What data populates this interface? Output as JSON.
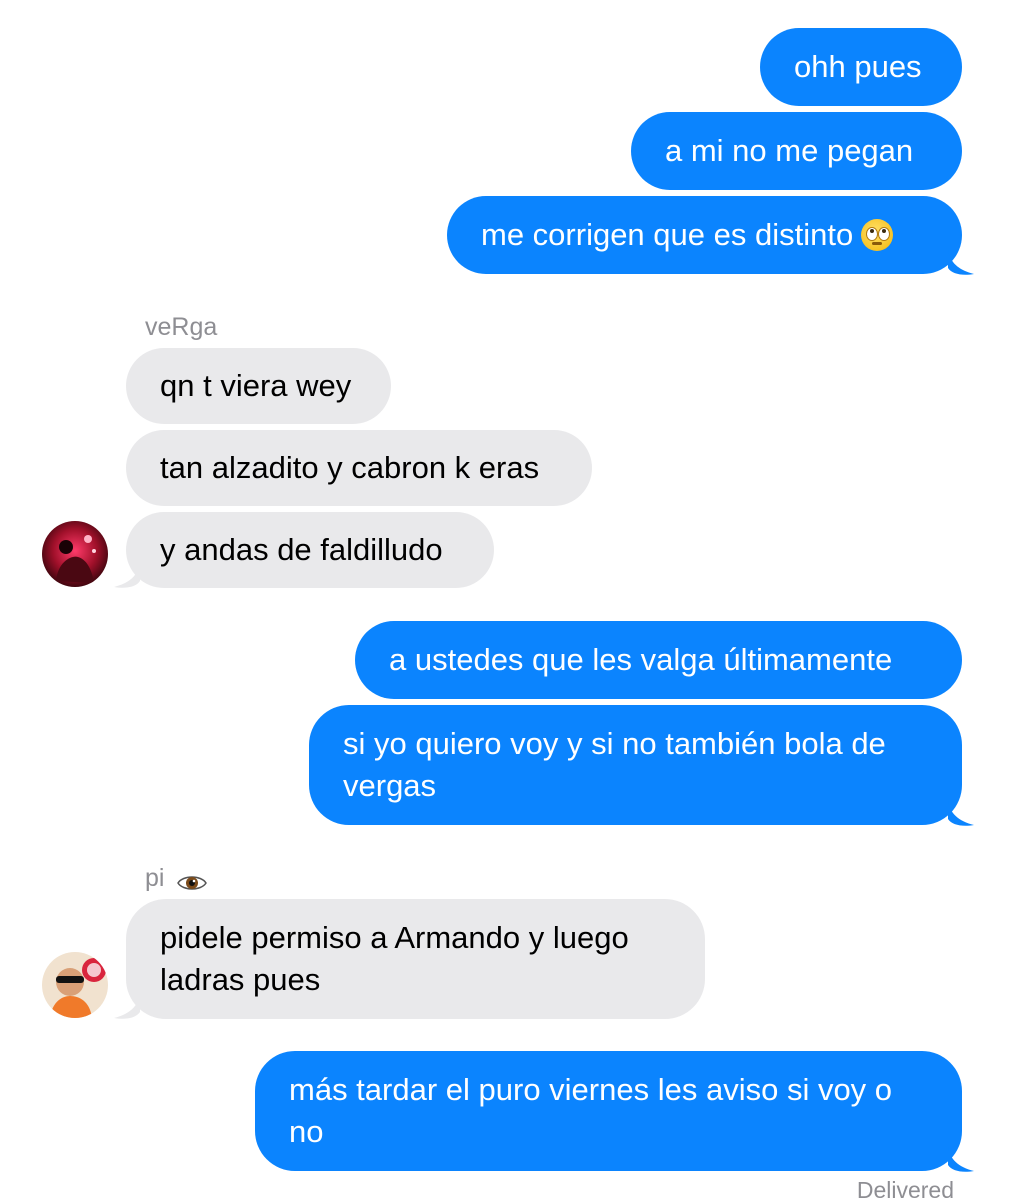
{
  "conversation": {
    "messages_out_1": [
      "ohh pues",
      "a mi no me pegan",
      "me corrigen que es distinto"
    ],
    "group_1": {
      "sender": "veRga",
      "messages": [
        "qn t viera wey",
        "tan alzadito y cabron k eras",
        "y andas de faldilludo"
      ],
      "avatar": "avatar-verga"
    },
    "messages_out_2": [
      "a ustedes que les valga últimamente",
      "si yo quiero voy y si no también bola de vergas"
    ],
    "group_2": {
      "sender": "pi",
      "sender_emoji": "eye-icon",
      "messages": [
        "pidele permiso a Armando y luego ladras pues"
      ],
      "avatar": "avatar-pi"
    },
    "messages_out_3": [
      "más tardar el puro viernes les aviso si voy o no"
    ],
    "status": "Delivered"
  },
  "colors": {
    "outgoing_bubble": "#0b84fe",
    "incoming_bubble": "#e9e9eb",
    "meta_text": "#8e8e93"
  },
  "emoji": {
    "rolling_eyes": "face-with-rolling-eyes-icon"
  }
}
